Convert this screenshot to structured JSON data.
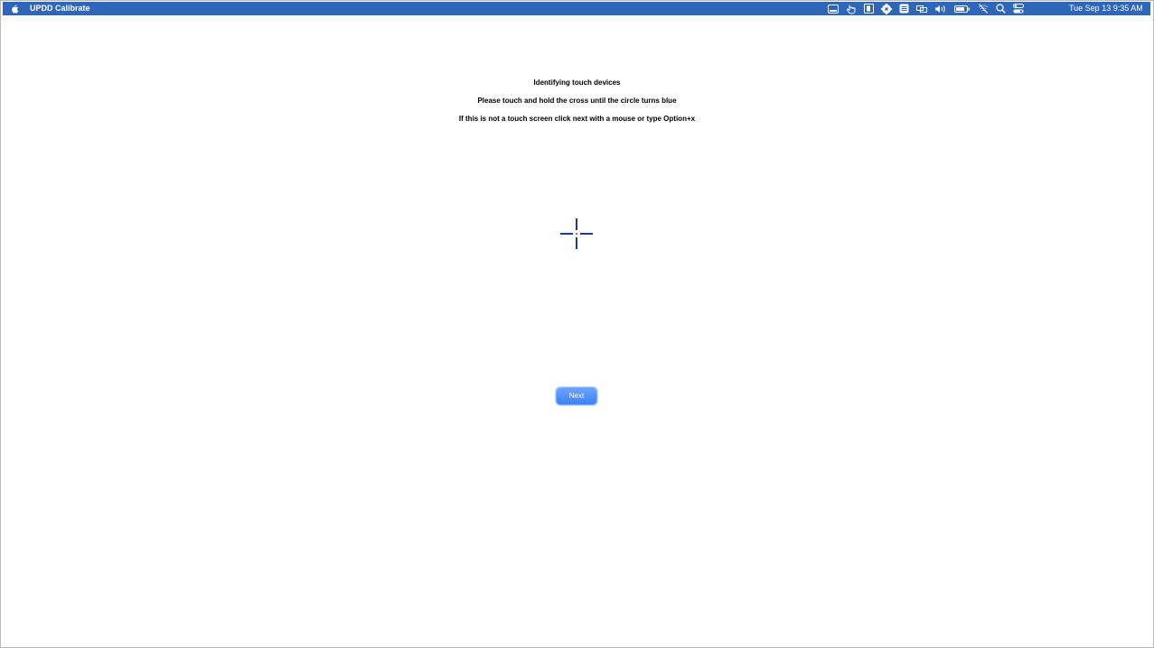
{
  "menubar": {
    "app_name": "UPDD Calibrate",
    "clock": "Tue Sep 13  9:35 AM",
    "status_icons": [
      "display-icon",
      "touch-hand-icon",
      "document-icon",
      "settings-badge-icon",
      "list-icon",
      "screen-mirroring-icon",
      "volume-icon",
      "battery-icon",
      "wifi-off-icon",
      "search-icon",
      "control-center-icon"
    ]
  },
  "calibration": {
    "title": "Identifying touch devices",
    "instruction": "Please touch and hold the cross until  the circle turns blue",
    "alternative": "If this is not a touch screen click next with a mouse or type Option+x",
    "next_label": "Next"
  },
  "colors": {
    "menubar": "#2e67b9",
    "crosshair": "#1f3a93",
    "crosshair_center": "#d9534f",
    "button": "#3b82f6"
  }
}
